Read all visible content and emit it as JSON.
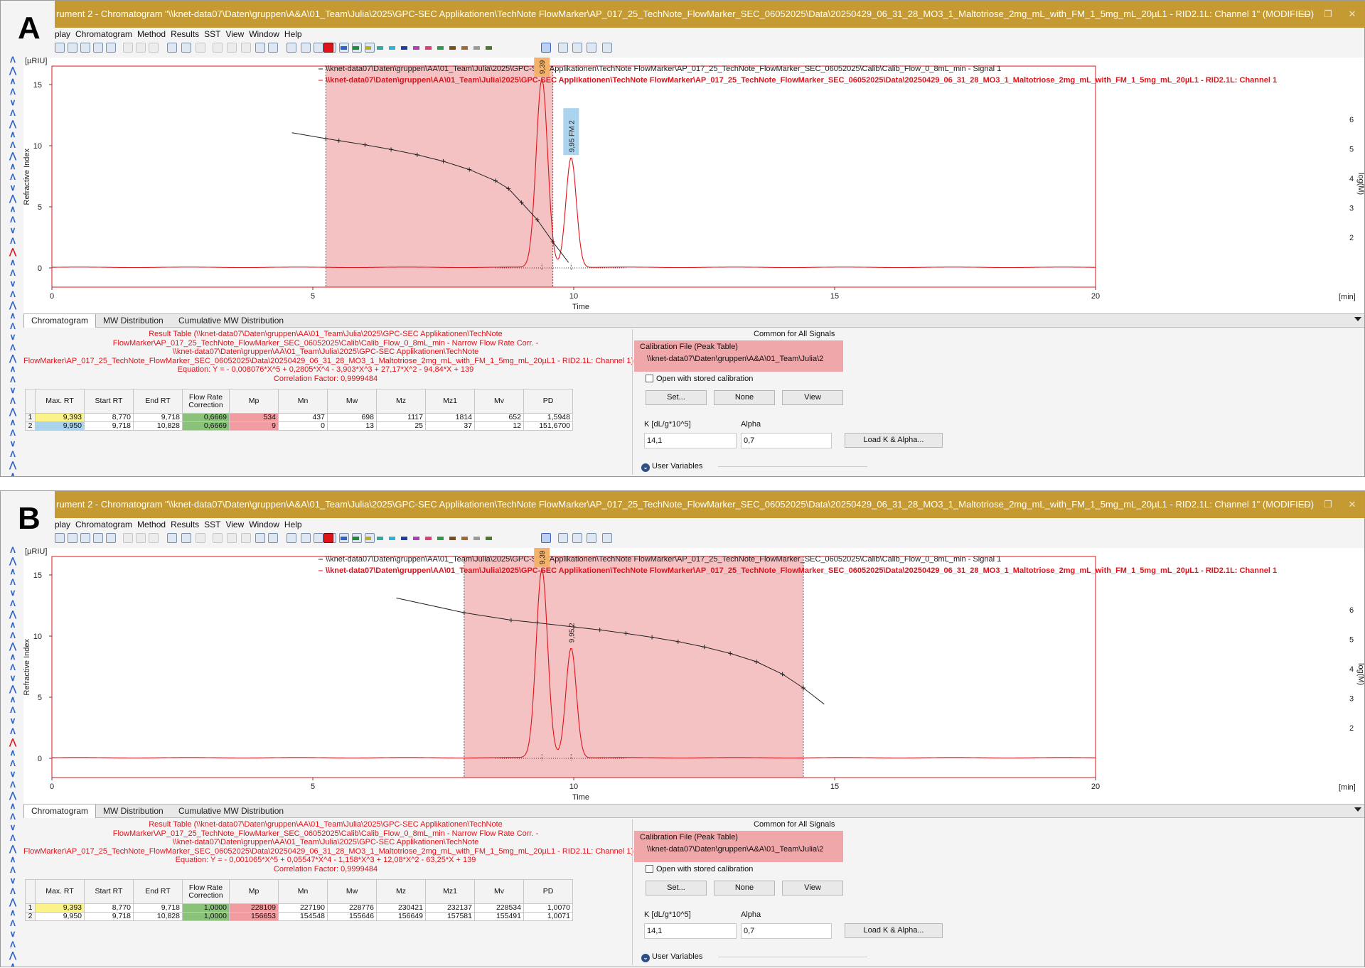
{
  "panels": [
    {
      "letter": "A",
      "title": "rument 2 - Chromatogram \"\\\\knet-data07\\Daten\\gruppen\\A&A\\01_Team\\Julia\\2025\\GPC-SEC Applikationen\\TechNote FlowMarker\\AP_017_25_TechNote_FlowMarker_SEC_06052025\\Data\\20250429_06_31_28_MO3_1_Maltotriose_2mg_mL_with_FM_1_5mg_mL_20µL1 - RID2.1L: Channel 1\" (MODIFIED)",
      "menu": [
        "play",
        "Chromatogram",
        "Method",
        "Results",
        "SST",
        "View",
        "Window",
        "Help"
      ],
      "plot": {
        "y_unit": "[µRIU]",
        "y_axis_label": "Refractive Index",
        "y_ticks": [
          "0",
          "5",
          "10",
          "15"
        ],
        "x_axis_label": "Time",
        "x_unit": "[min]",
        "x_ticks": [
          "0",
          "5",
          "10",
          "15",
          "20"
        ],
        "right_axis_label": "log(M)",
        "right_ticks": [
          "2",
          "3",
          "4",
          "5",
          "6"
        ],
        "legend": [
          {
            "text": "\\\\knet-data07\\Daten\\gruppen\\AA\\01_Team\\Julia\\2025\\GPC-SEC Applikationen\\TechNote FlowMarker\\AP_017_25_TechNote_FlowMarker_SEC_06052025\\Calib\\Calib_Flow_0_8mL_min - Signal 1",
            "color": "#222222"
          },
          {
            "text": "\\\\knet-data07\\Daten\\gruppen\\AA\\01_Team\\Julia\\2025\\GPC-SEC Applikationen\\TechNote FlowMarker\\AP_017_25_TechNote_FlowMarker_SEC_06052025\\Data\\20250429_06_31_28_MO3_1_Maltotriose_2mg_mL_with_FM_1_5mg_mL_20µL1 - RID2.1L: Channel 1",
            "color": "#e0131a"
          }
        ],
        "peaks": [
          {
            "label": "9,39   1",
            "rt": 9.39,
            "height": 15.4,
            "color": "#f2b26b"
          },
          {
            "label": "9,95   FM 2",
            "rt": 9.95,
            "height": 9.0,
            "color": "#aad3ee"
          }
        ],
        "calib_region": [
          5.25,
          9.6
        ],
        "calib_curve": {
          "x": [
            4.6,
            5.25,
            5.5,
            6.0,
            6.5,
            7.0,
            7.5,
            8.0,
            8.5,
            8.75,
            9.0,
            9.3,
            9.6,
            9.9
          ],
          "y": [
            5.55,
            5.35,
            5.28,
            5.14,
            4.98,
            4.8,
            4.58,
            4.3,
            3.92,
            3.65,
            3.18,
            2.6,
            1.85,
            1.15
          ]
        }
      },
      "tabs": [
        "Chromatogram",
        "MW Distribution",
        "Cumulative MW Distribution"
      ],
      "result_text": [
        "Result Table (\\\\knet-data07\\Daten\\gruppen\\AA\\01_Team\\Julia\\2025\\GPC-SEC Applikationen\\TechNote",
        "FlowMarker\\AP_017_25_TechNote_FlowMarker_SEC_06052025\\Calib\\Calib_Flow_0_8mL_min - Narrow Flow Rate Corr. -",
        "\\\\knet-data07\\Daten\\gruppen\\AA\\01_Team\\Julia\\2025\\GPC-SEC Applikationen\\TechNote",
        "FlowMarker\\AP_017_25_TechNote_FlowMarker_SEC_06052025\\Data\\20250429_06_31_28_MO3_1_Maltotriose_2mg_mL_with_FM_1_5mg_mL_20µL1 - RID2.1L: Channel 1)",
        "Equation: Y = - 0,008076*X^5 + 0,2805*X^4 - 3,903*X^3 + 27,17*X^2 - 94,84*X + 139",
        "Correlation Factor: 0,9999484"
      ],
      "table": {
        "headers": [
          "Max. RT",
          "Start RT",
          "End RT",
          "Flow Rate Correction",
          "Mp",
          "Mn",
          "Mw",
          "Mz",
          "Mz1",
          "Mv",
          "PD"
        ],
        "rows": [
          [
            "1",
            "9,393",
            "8,770",
            "9,718",
            "0,6669",
            "534",
            "437",
            "698",
            "1117",
            "1814",
            "652",
            "1,5948"
          ],
          [
            "2",
            "9,950",
            "9,718",
            "10,828",
            "0,6669",
            "9",
            "0",
            "13",
            "25",
            "37",
            "12",
            "151,6700"
          ]
        ]
      },
      "right": {
        "common_label": "Common for All Signals",
        "calib_title": "Calibration File (Peak Table)",
        "calib_path": "\\\\knet-data07\\Daten\\gruppen\\A&A\\01_Team\\Julia\\2",
        "checkbox_label": "Open with stored calibration",
        "btn_set": "Set...",
        "btn_none": "None",
        "btn_view": "View",
        "k_label": "K [dL/g*10^5]",
        "k_value": "14,1",
        "alpha_label": "Alpha",
        "alpha_value": "0,7",
        "btn_load": "Load K & Alpha...",
        "user_vars": "User Variables"
      }
    },
    {
      "letter": "B",
      "title": "rument 2 - Chromatogram \"\\\\knet-data07\\Daten\\gruppen\\A&A\\01_Team\\Julia\\2025\\GPC-SEC Applikationen\\TechNote FlowMarker\\AP_017_25_TechNote_FlowMarker_SEC_06052025\\Data\\20250429_06_31_28_MO3_1_Maltotriose_2mg_mL_with_FM_1_5mg_mL_20µL1 - RID2.1L: Channel 1\" (MODIFIED)",
      "menu": [
        "play",
        "Chromatogram",
        "Method",
        "Results",
        "SST",
        "View",
        "Window",
        "Help"
      ],
      "plot": {
        "y_unit": "[µRIU]",
        "y_axis_label": "Refractive Index",
        "y_ticks": [
          "0",
          "5",
          "10",
          "15"
        ],
        "x_axis_label": "Time",
        "x_unit": "[min]",
        "x_ticks": [
          "0",
          "5",
          "10",
          "15",
          "20"
        ],
        "right_axis_label": "log(M)",
        "right_ticks": [
          "2",
          "3",
          "4",
          "5",
          "6"
        ],
        "legend": [
          {
            "text": "\\\\knet-data07\\Daten\\gruppen\\AA\\01_Team\\Julia\\2025\\GPC-SEC Applikationen\\TechNote FlowMarker\\AP_017_25_TechNote_FlowMarker_SEC_06052025\\Calib\\Calib_Flow_0_8mL_min - Signal 1",
            "color": "#222222"
          },
          {
            "text": "\\\\knet-data07\\Daten\\gruppen\\AA\\01_Team\\Julia\\2025\\GPC-SEC Applikationen\\TechNote FlowMarker\\AP_017_25_TechNote_FlowMarker_SEC_06052025\\Data\\20250429_06_31_28_MO3_1_Maltotriose_2mg_mL_with_FM_1_5mg_mL_20µL1 - RID2.1L: Channel 1",
            "color": "#e0131a"
          }
        ],
        "peaks": [
          {
            "label": "9,39   1",
            "rt": 9.39,
            "height": 15.4,
            "color": "#f2b26b"
          },
          {
            "label": "9,95   2",
            "rt": 9.95,
            "height": 9.0,
            "color": ""
          }
        ],
        "calib_region": [
          7.9,
          14.4
        ],
        "calib_curve": {
          "x": [
            6.6,
            7.9,
            8.8,
            9.3,
            10.0,
            10.5,
            11.0,
            11.5,
            12.0,
            12.5,
            13.0,
            13.5,
            14.0,
            14.4,
            14.8
          ],
          "y": [
            6.4,
            5.9,
            5.65,
            5.56,
            5.42,
            5.32,
            5.2,
            5.07,
            4.92,
            4.74,
            4.52,
            4.24,
            3.82,
            3.35,
            2.8
          ]
        }
      },
      "tabs": [
        "Chromatogram",
        "MW Distribution",
        "Cumulative MW Distribution"
      ],
      "result_text": [
        "Result Table (\\\\knet-data07\\Daten\\gruppen\\AA\\01_Team\\Julia\\2025\\GPC-SEC Applikationen\\TechNote",
        "FlowMarker\\AP_017_25_TechNote_FlowMarker_SEC_06052025\\Calib\\Calib_Flow_0_8mL_min - Narrow Flow Rate Corr. -",
        "\\\\knet-data07\\Daten\\gruppen\\AA\\01_Team\\Julia\\2025\\GPC-SEC Applikationen\\TechNote",
        "FlowMarker\\AP_017_25_TechNote_FlowMarker_SEC_06052025\\Data\\20250429_06_31_28_MO3_1_Maltotriose_2mg_mL_with_FM_1_5mg_mL_20µL1 - RID2.1L: Channel 1)",
        "Equation: Y = - 0,001065*X^5 + 0,05547*X^4 - 1,158*X^3 + 12,08*X^2 - 63,25*X + 139",
        "Correlation Factor: 0,9999484"
      ],
      "table": {
        "headers": [
          "Max. RT",
          "Start RT",
          "End RT",
          "Flow Rate Correction",
          "Mp",
          "Mn",
          "Mw",
          "Mz",
          "Mz1",
          "Mv",
          "PD"
        ],
        "rows": [
          [
            "1",
            "9,393",
            "8,770",
            "9,718",
            "1,0000",
            "228109",
            "227190",
            "228776",
            "230421",
            "232137",
            "228534",
            "1,0070"
          ],
          [
            "2",
            "9,950",
            "9,718",
            "10,828",
            "1,0000",
            "156653",
            "154548",
            "155646",
            "156649",
            "157581",
            "155491",
            "1,0071"
          ]
        ]
      },
      "right": {
        "common_label": "Common for All Signals",
        "calib_title": "Calibration File (Peak Table)",
        "calib_path": "\\\\knet-data07\\Daten\\gruppen\\A&A\\01_Team\\Julia\\2",
        "checkbox_label": "Open with stored calibration",
        "btn_set": "Set...",
        "btn_none": "None",
        "btn_view": "View",
        "k_label": "K [dL/g*10^5]",
        "k_value": "14,1",
        "alpha_label": "Alpha",
        "alpha_value": "0,7",
        "btn_load": "Load K & Alpha...",
        "user_vars": "User Variables"
      }
    }
  ],
  "colors": {
    "titlebar": "#c59a33",
    "signal": "#e0131a",
    "calib_region": "#f5c2c4",
    "calib_curve": "#222222"
  }
}
